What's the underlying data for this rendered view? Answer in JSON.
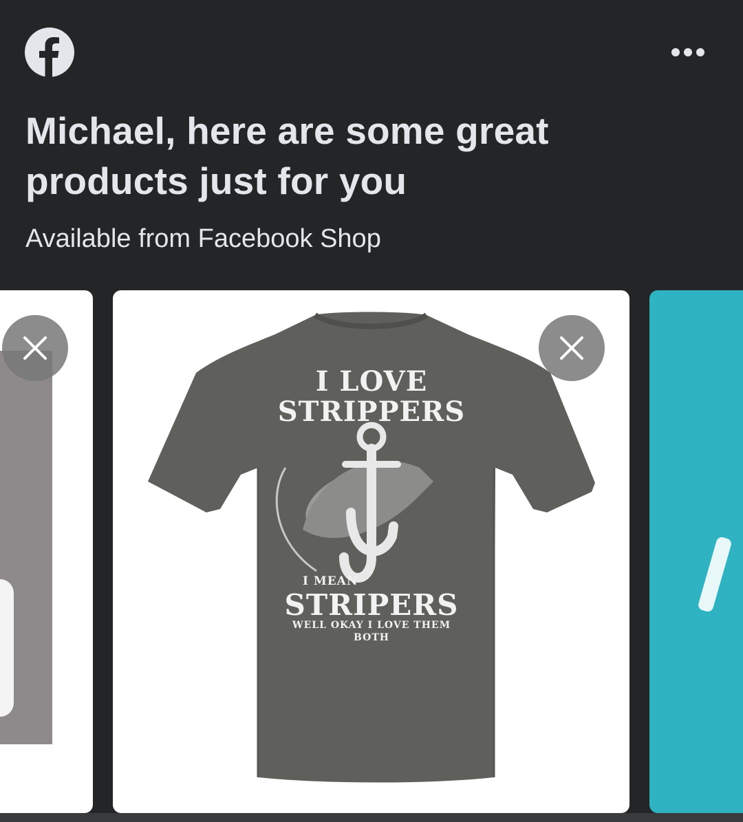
{
  "header": {
    "logo_icon": "facebook-logo-icon",
    "more_icon": "more-options-icon"
  },
  "headline": "Michael, here are some great products just for you",
  "subtitle": "Available from Facebook Shop",
  "carousel": {
    "cards": [
      {
        "image": "white-shirt-on-gray-background",
        "hide_icon": "close-icon"
      },
      {
        "image": "charcoal-tshirt-fish-graphic",
        "hide_icon": "close-icon",
        "print": {
          "line1": "I LOVE",
          "line2": "STRIPPERS",
          "line3": "I MEAN",
          "line4": "STRIPERS",
          "line5": "WELL OKAY I LOVE THEM BOTH"
        }
      },
      {
        "image": "teal-product-image"
      }
    ]
  },
  "colors": {
    "background": "#242526",
    "text": "#e4e6eb",
    "shirt": "#5f5f5c",
    "teal": "#2fb3c2"
  }
}
